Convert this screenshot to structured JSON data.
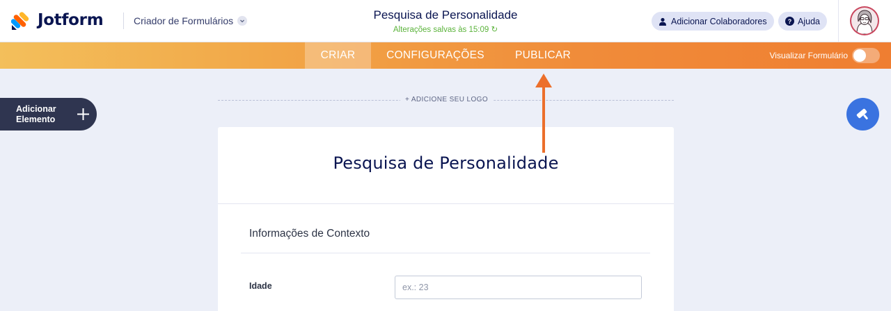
{
  "header": {
    "brand": "Jotform",
    "builder_label": "Criador de Formulários",
    "form_title": "Pesquisa de Personalidade",
    "saved_status": "Alterações salvas às 15:09",
    "add_collaborators": "Adicionar Colaboradores",
    "help": "Ajuda"
  },
  "nav": {
    "tabs": [
      {
        "label": "CRIAR",
        "active": true
      },
      {
        "label": "CONFIGURAÇÕES",
        "active": false
      },
      {
        "label": "PUBLICAR",
        "active": false
      }
    ],
    "preview_label": "Visualizar Formulário",
    "preview_on": false
  },
  "left_panel": {
    "add_element_line1": "Adicionar",
    "add_element_line2": "Elemento"
  },
  "canvas": {
    "add_logo": "+ ADICIONE SEU LOGO"
  },
  "form": {
    "heading": "Pesquisa de Personalidade",
    "section_title": "Informações de Contexto",
    "fields": [
      {
        "label": "Idade",
        "placeholder": "ex.: 23",
        "value": ""
      }
    ]
  },
  "colors": {
    "nav_gradient_start": "#f3bf5b",
    "nav_gradient_end": "#ef7e31",
    "annotation_arrow": "#ec6f2b",
    "paint_button": "#3a73e0",
    "saved_text": "#5bb33b"
  }
}
